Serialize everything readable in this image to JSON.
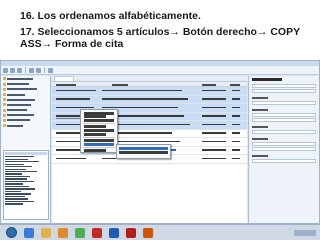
{
  "slide": {
    "title": "16. Los ordenamos alfabéticamente.",
    "body_line1": "17. Seleccionamos 5 artículos→ Botón derecho→ COPY",
    "body_line2": "ASS→ Forma de cita"
  },
  "colors": {
    "selection": "#c8dcf6",
    "menu_highlight": "#2f6cc0",
    "taskbar": "#cfd9e6",
    "window_chrome": "#dce6f2"
  },
  "taskbar": {
    "apps": [
      {
        "icon": "windows-start-icon"
      },
      {
        "icon": "internet-explorer-icon",
        "color": "#3a7bd5"
      },
      {
        "icon": "explorer-folder-icon",
        "color": "#e1b34a"
      },
      {
        "icon": "media-player-icon",
        "color": "#e08a2a"
      },
      {
        "icon": "chrome-icon",
        "color": "#4caf50"
      },
      {
        "icon": "acrobat-icon",
        "color": "#c62828"
      },
      {
        "icon": "word-icon",
        "color": "#1e5bb8"
      },
      {
        "icon": "zotero-icon",
        "color": "#b71c1c"
      },
      {
        "icon": "powerpoint-icon",
        "color": "#d35400"
      }
    ]
  }
}
